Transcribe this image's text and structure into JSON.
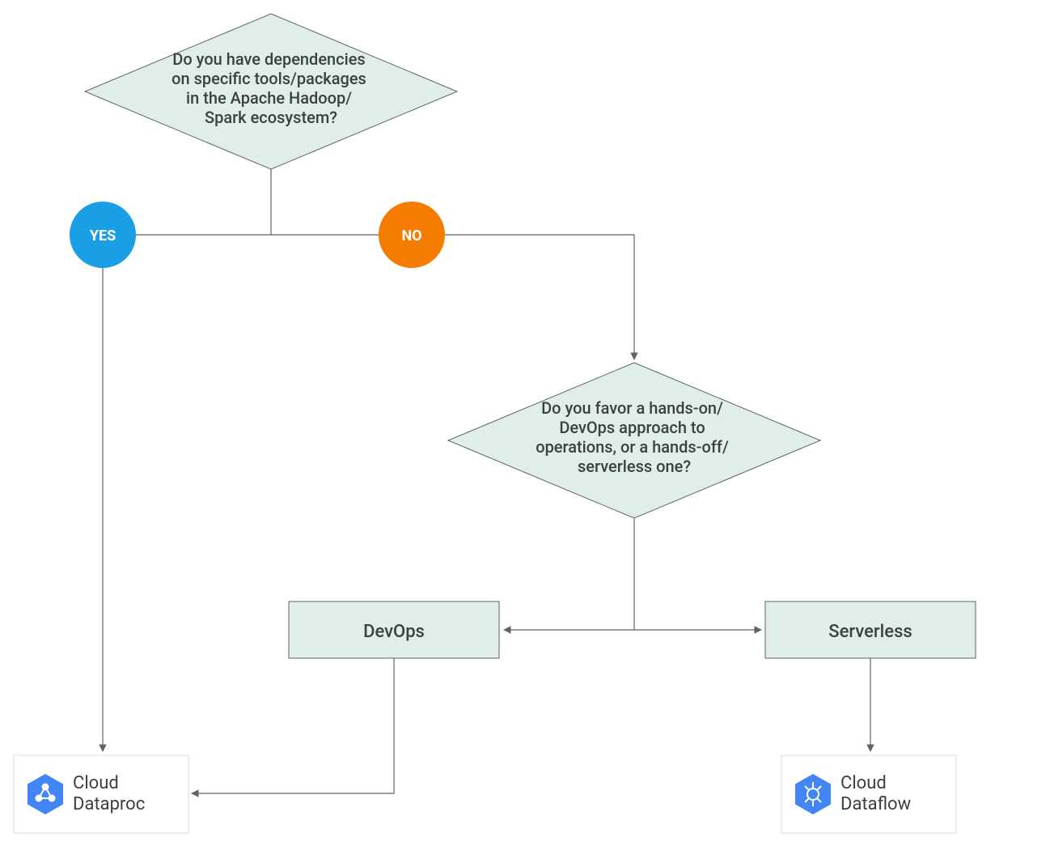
{
  "q1": {
    "line1": "Do you have dependencies",
    "line2": "on specific tools/packages",
    "line3": "in the Apache Hadoop/",
    "line4": "Spark ecosystem?"
  },
  "q2": {
    "line1": "Do you favor a hands-on/",
    "line2": "DevOps approach to",
    "line3": "operations, or a hands-off/",
    "line4": "serverless one?"
  },
  "labels": {
    "yes": "YES",
    "no": "NO",
    "devops": "DevOps",
    "serverless": "Serverless"
  },
  "products": {
    "dataproc": {
      "line1": "Cloud",
      "line2": "Dataproc"
    },
    "dataflow": {
      "line1": "Cloud",
      "line2": "Dataflow"
    }
  }
}
